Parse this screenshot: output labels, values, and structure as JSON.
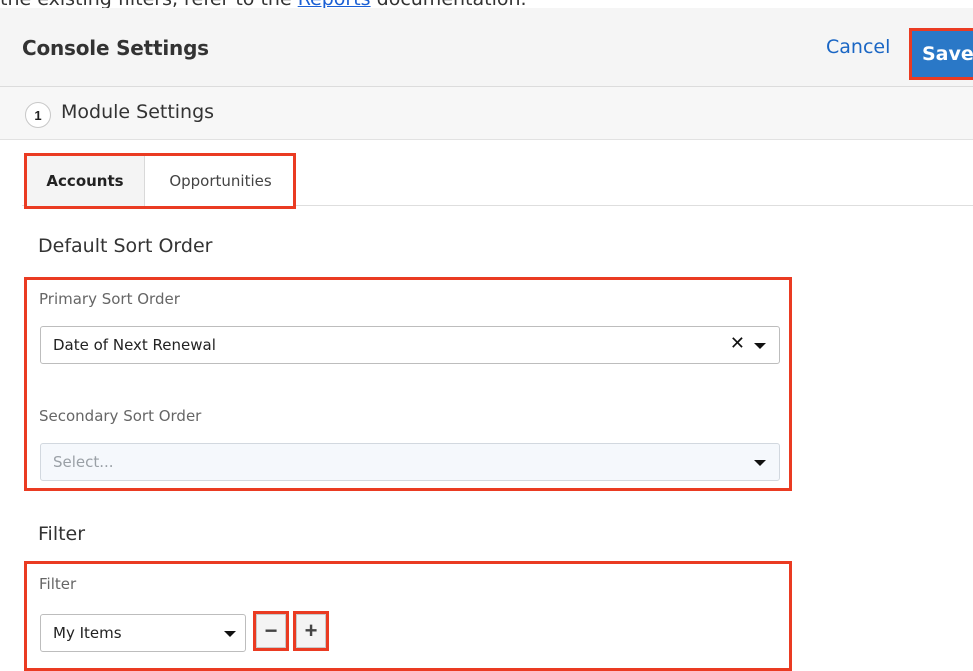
{
  "top_clip": {
    "text_before": "the existing filters, refer to the ",
    "link": "Reports",
    "text_after": " documentation."
  },
  "header": {
    "title": "Console Settings",
    "cancel_label": "Cancel",
    "save_label": "Save"
  },
  "step": {
    "number": "1",
    "label": "Module Settings"
  },
  "tabs": [
    {
      "label": "Accounts",
      "active": true
    },
    {
      "label": "Opportunities",
      "active": false
    }
  ],
  "sort": {
    "heading": "Default Sort Order",
    "primary_label": "Primary Sort Order",
    "primary_value": "Date of Next Renewal",
    "secondary_label": "Secondary Sort Order",
    "secondary_placeholder": "Select..."
  },
  "filter": {
    "heading": "Filter",
    "label": "Filter",
    "value": "My Items",
    "remove_symbol": "−",
    "add_symbol": "+"
  },
  "colors": {
    "highlight": "#ea3b22",
    "primary_button": "#2a78c7",
    "link": "#1a66c4"
  },
  "icons": {
    "clear": "close-icon",
    "dropdown": "chevron-down-icon",
    "remove": "minus-icon",
    "add": "plus-icon"
  }
}
